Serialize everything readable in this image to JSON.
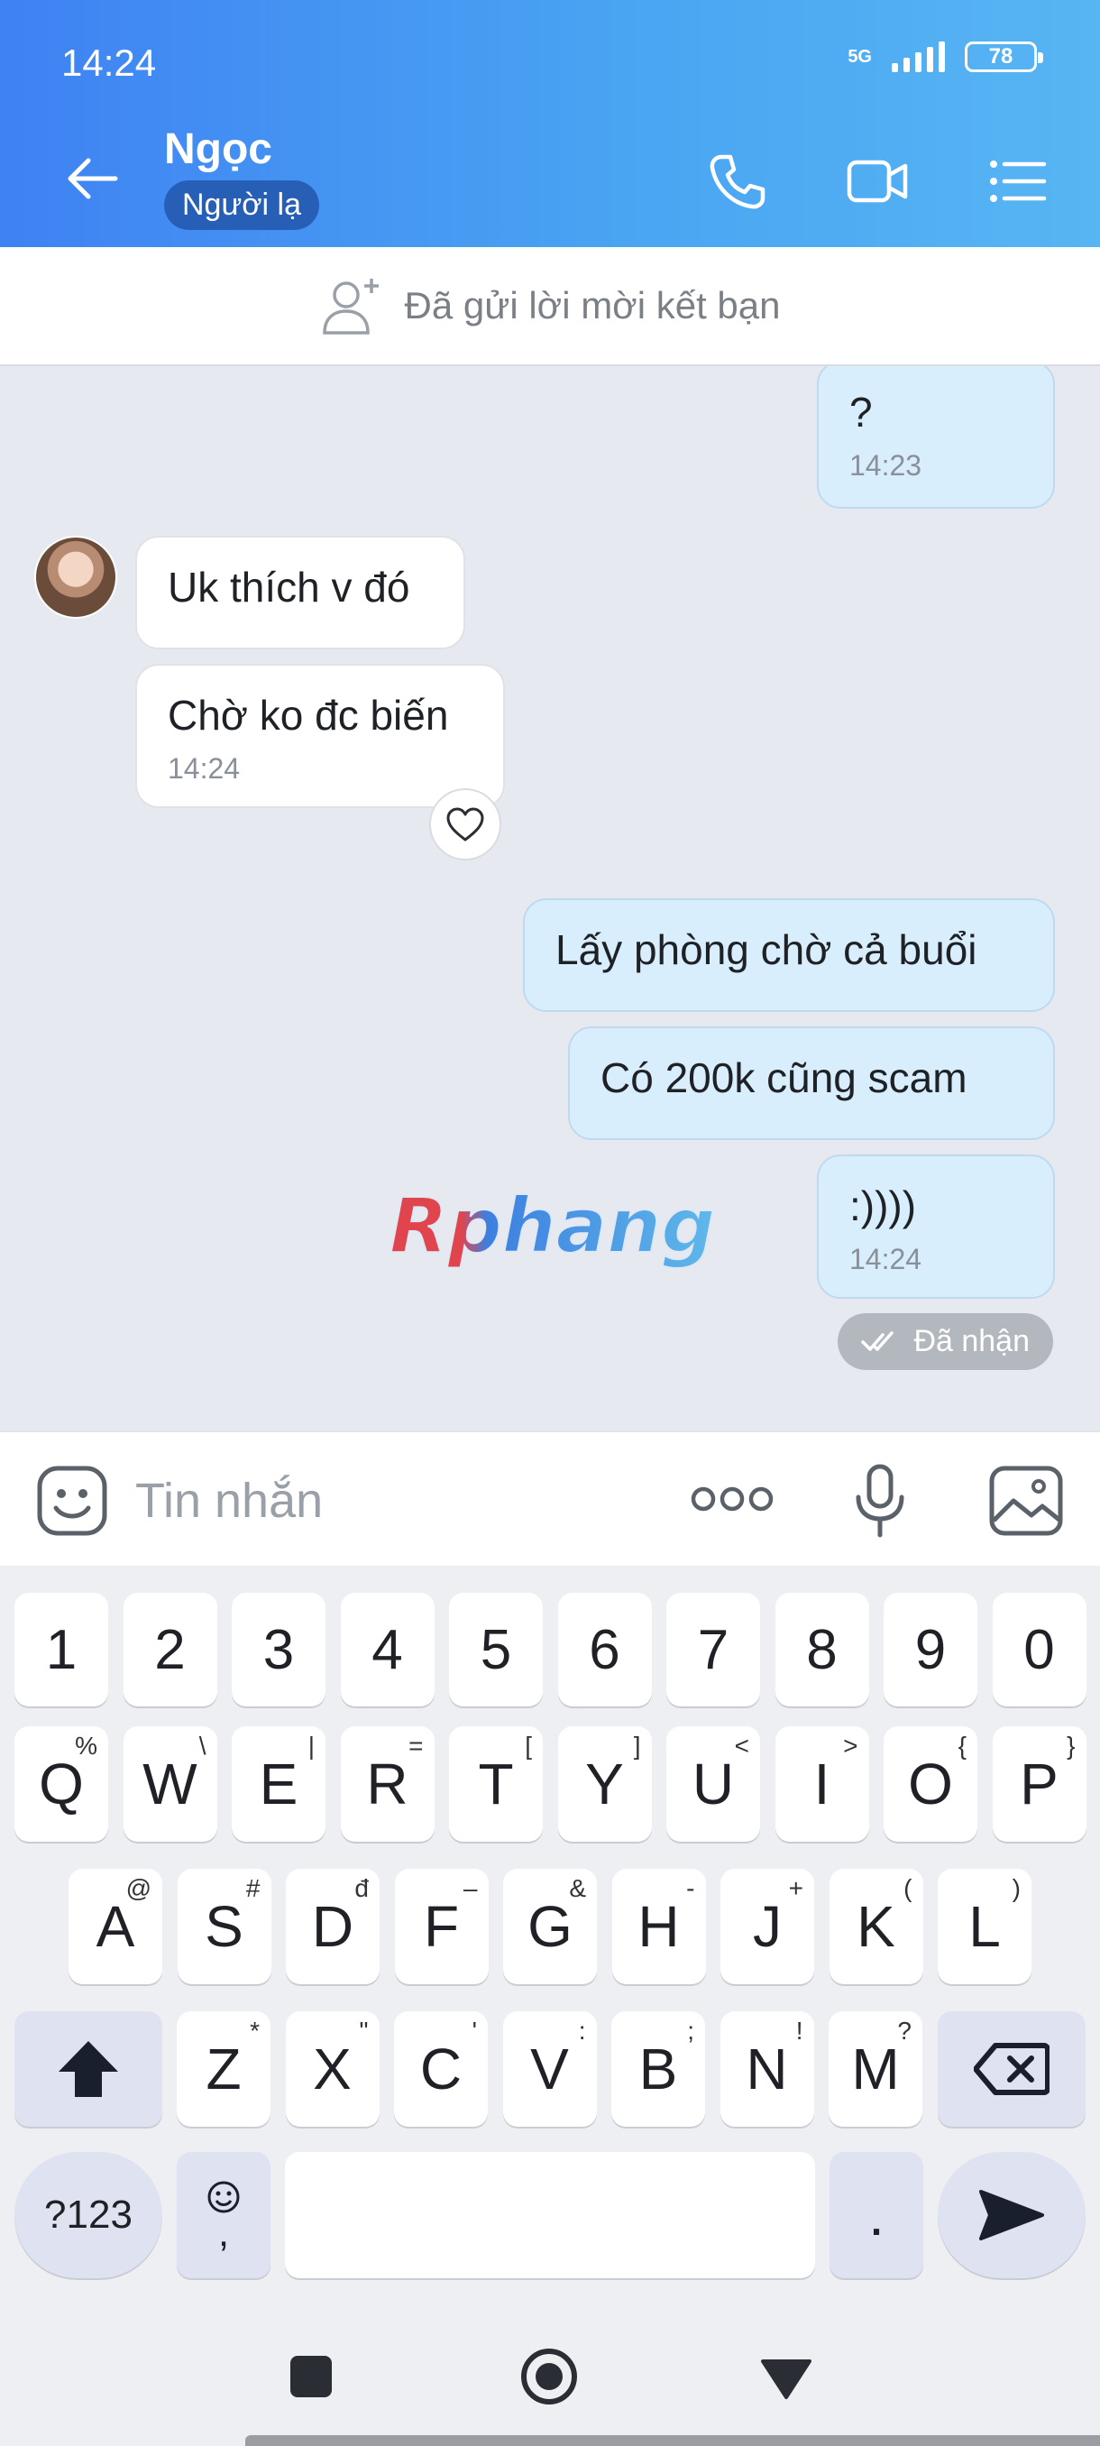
{
  "status": {
    "time": "14:24",
    "network": "5G",
    "battery": "78"
  },
  "header": {
    "name": "Ngọc",
    "badge": "Người lạ"
  },
  "friend_bar": {
    "text": "Đã gửi lời mời kết bạn"
  },
  "messages": [
    {
      "side": "out",
      "text": "?",
      "time": "14:23"
    },
    {
      "side": "in",
      "text": "Uk thích v đó"
    },
    {
      "side": "in",
      "text": "Chờ ko đc biến",
      "time": "14:24"
    },
    {
      "side": "out",
      "text": "Lấy phòng chờ cả buổi"
    },
    {
      "side": "out",
      "text": "Có 200k cũng scam"
    },
    {
      "side": "out",
      "text": ":))))",
      "time": "14:24"
    }
  ],
  "received_label": "Đã nhận",
  "watermark": "Rphang",
  "input": {
    "placeholder": "Tin nhắn"
  },
  "keyboard": {
    "row_numbers": [
      "1",
      "2",
      "3",
      "4",
      "5",
      "6",
      "7",
      "8",
      "9",
      "0"
    ],
    "row1": [
      {
        "k": "Q",
        "s": "%"
      },
      {
        "k": "W",
        "s": "\\"
      },
      {
        "k": "E",
        "s": "|"
      },
      {
        "k": "R",
        "s": "="
      },
      {
        "k": "T",
        "s": "["
      },
      {
        "k": "Y",
        "s": "]"
      },
      {
        "k": "U",
        "s": "<"
      },
      {
        "k": "I",
        "s": ">"
      },
      {
        "k": "O",
        "s": "{"
      },
      {
        "k": "P",
        "s": "}"
      }
    ],
    "row2": [
      {
        "k": "A",
        "s": "@"
      },
      {
        "k": "S",
        "s": "#"
      },
      {
        "k": "D",
        "s": "đ"
      },
      {
        "k": "F",
        "s": "–"
      },
      {
        "k": "G",
        "s": "&"
      },
      {
        "k": "H",
        "s": "-"
      },
      {
        "k": "J",
        "s": "+"
      },
      {
        "k": "K",
        "s": "("
      },
      {
        "k": "L",
        "s": ")"
      }
    ],
    "row3": [
      {
        "k": "Z",
        "s": "*"
      },
      {
        "k": "X",
        "s": "\""
      },
      {
        "k": "C",
        "s": "'"
      },
      {
        "k": "V",
        "s": ":"
      },
      {
        "k": "B",
        "s": ";"
      },
      {
        "k": "N",
        "s": "!"
      },
      {
        "k": "M",
        "s": "?"
      }
    ],
    "symbols_label": "?123",
    "emoji_comma_label": ",",
    "period_label": "."
  },
  "colors": {
    "header_start": "#3f82f3",
    "header_end": "#58b5f3",
    "out_bubble": "#d9eefc",
    "in_bubble": "#ffffff"
  }
}
